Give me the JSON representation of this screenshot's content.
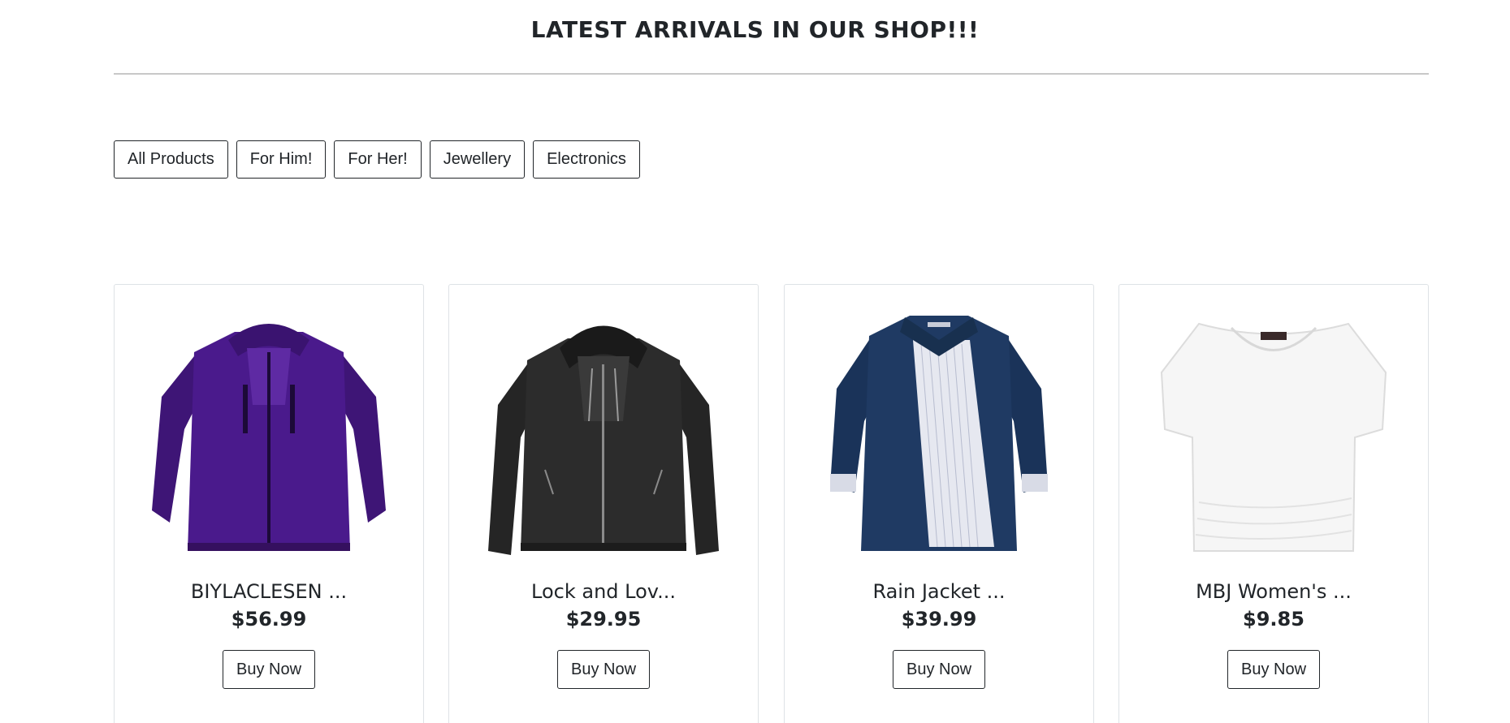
{
  "heading": "LATEST ARRIVALS IN OUR SHOP!!!",
  "filters": [
    {
      "label": "All Products"
    },
    {
      "label": "For Him!"
    },
    {
      "label": "For Her!"
    },
    {
      "label": "Jewellery"
    },
    {
      "label": "Electronics"
    }
  ],
  "products": [
    {
      "title": "BIYLACLESEN ...",
      "price": "$56.99",
      "button": "Buy Now",
      "image": "purple-hooded-jacket",
      "color": "#4a1a8c"
    },
    {
      "title": "Lock and Lov...",
      "price": "$29.95",
      "button": "Buy Now",
      "image": "black-leather-hooded-jacket",
      "color": "#1e1e1e"
    },
    {
      "title": "Rain Jacket ...",
      "price": "$39.99",
      "button": "Buy Now",
      "image": "navy-rain-jacket",
      "color": "#1f3a63"
    },
    {
      "title": "MBJ Women's ...",
      "price": "$9.85",
      "button": "Buy Now",
      "image": "white-tshirt",
      "color": "#f4f4f4"
    }
  ],
  "colors": {
    "text": "#212529",
    "divider": "#c8c8c8",
    "card_border": "#dee2e6"
  }
}
